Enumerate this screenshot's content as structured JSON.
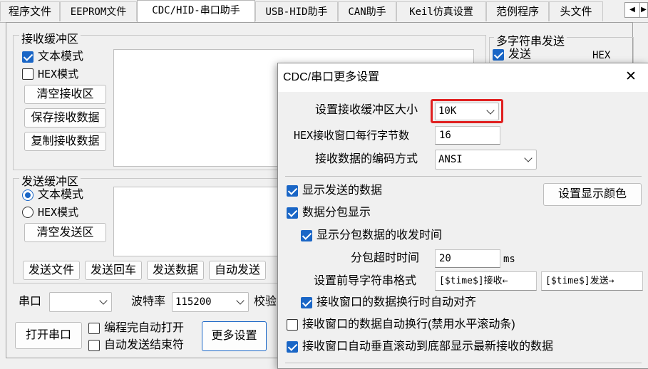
{
  "tabs": [
    {
      "label": "程序文件"
    },
    {
      "label": "EEPROM文件"
    },
    {
      "label": "CDC/HID-串口助手"
    },
    {
      "label": "USB-HID助手"
    },
    {
      "label": "CAN助手"
    },
    {
      "label": "Keil仿真设置"
    },
    {
      "label": "范例程序"
    },
    {
      "label": "头文件"
    }
  ],
  "tab_scroll": {
    "left": "◀",
    "right": "▶"
  },
  "receive": {
    "title": "接收缓冲区",
    "text_mode": "文本模式",
    "hex_mode": "HEX模式",
    "clear": "清空接收区",
    "save": "保存接收数据",
    "copy": "复制接收数据",
    "text_mode_checked": true,
    "hex_mode_checked": false
  },
  "send": {
    "title": "发送缓冲区",
    "text_mode": "文本模式",
    "hex_mode": "HEX模式",
    "clear": "清空发送区",
    "selected_mode": "text",
    "actions": {
      "send_file": "发送文件",
      "send_enter": "发送回车",
      "send_data": "发送数据",
      "auto_send": "自动发送"
    }
  },
  "multi": {
    "title": "多字符串发送",
    "send": "发送",
    "hex": "HEX",
    "send_checked": true
  },
  "port": {
    "port_label": "串口",
    "port_value": "",
    "baud_label": "波特率",
    "baud_value": "115200",
    "parity_label": "校验",
    "open": "打开串口",
    "auto_open": "编程完自动打开",
    "auto_send_end": "自动发送结束符",
    "more": "更多设置"
  },
  "dialog": {
    "title": "CDC/串口更多设置",
    "close": "✕",
    "buffer_size_label": "设置接收缓冲区大小",
    "buffer_size_value": "10K",
    "hex_bytes_label": "HEX接收窗口每行字节数",
    "hex_bytes_value": "16",
    "encoding_label": "接收数据的编码方式",
    "encoding_value": "ANSI",
    "show_sent": "显示发送的数据",
    "show_color_btn": "设置显示颜色",
    "packet_display": "数据分包显示",
    "show_packet_time": "显示分包数据的收发时间",
    "packet_timeout_label": "分包超时时间",
    "packet_timeout_value": "20",
    "packet_timeout_unit": "ms",
    "prefix_label": "设置前导字符串格式",
    "prefix_recv": "[$time$]接收←",
    "prefix_send": "[$time$]发送→",
    "auto_align": "接收窗口的数据换行时自动对齐",
    "auto_wrap": "接收窗口的数据自动换行(禁用水平滚动条)",
    "auto_scroll": "接收窗口自动垂直滚动到底部显示最新接收的数据",
    "checks": {
      "show_sent": true,
      "packet_display": true,
      "show_packet_time": true,
      "auto_align": true,
      "auto_wrap": false,
      "auto_scroll": true
    },
    "highlight_color": "#e02020"
  },
  "colors": {
    "accent": "#1a66c6"
  }
}
